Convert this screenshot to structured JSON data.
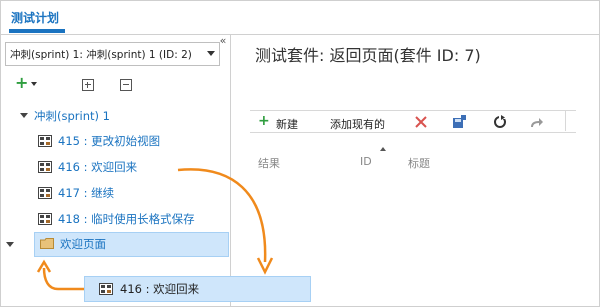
{
  "tabs": {
    "active": "测试计划"
  },
  "left": {
    "collapse_glyph": "«",
    "plan_select": "冲刺(sprint) 1: 冲刺(sprint) 1 (ID: 2)",
    "toolbar": {
      "new_icon": "plus-icon",
      "expand_icon": "expand-all-icon",
      "collapse_icon": "collapse-all-icon"
    },
    "tree": {
      "root": "冲刺(sprint) 1",
      "items": [
        "415 : 更改初始视图",
        "416 : 欢迎回来",
        "417 : 继续",
        "418 : 临时使用长格式保存"
      ],
      "selected": "欢迎页面"
    },
    "drag_item": "416 : 欢迎回来"
  },
  "right": {
    "title": "测试套件: 返回页面(套件 ID: 7)",
    "toolbar": {
      "new_label": "新建",
      "add_existing_label": "添加现有的"
    },
    "columns": {
      "result": "结果",
      "id": "ID",
      "title": "标题"
    }
  },
  "colors": {
    "accent": "#1a73c0",
    "arrow": "#f08a1c",
    "selection": "#cfe6fb",
    "green": "#2f9e3f",
    "red": "#d9534f"
  }
}
